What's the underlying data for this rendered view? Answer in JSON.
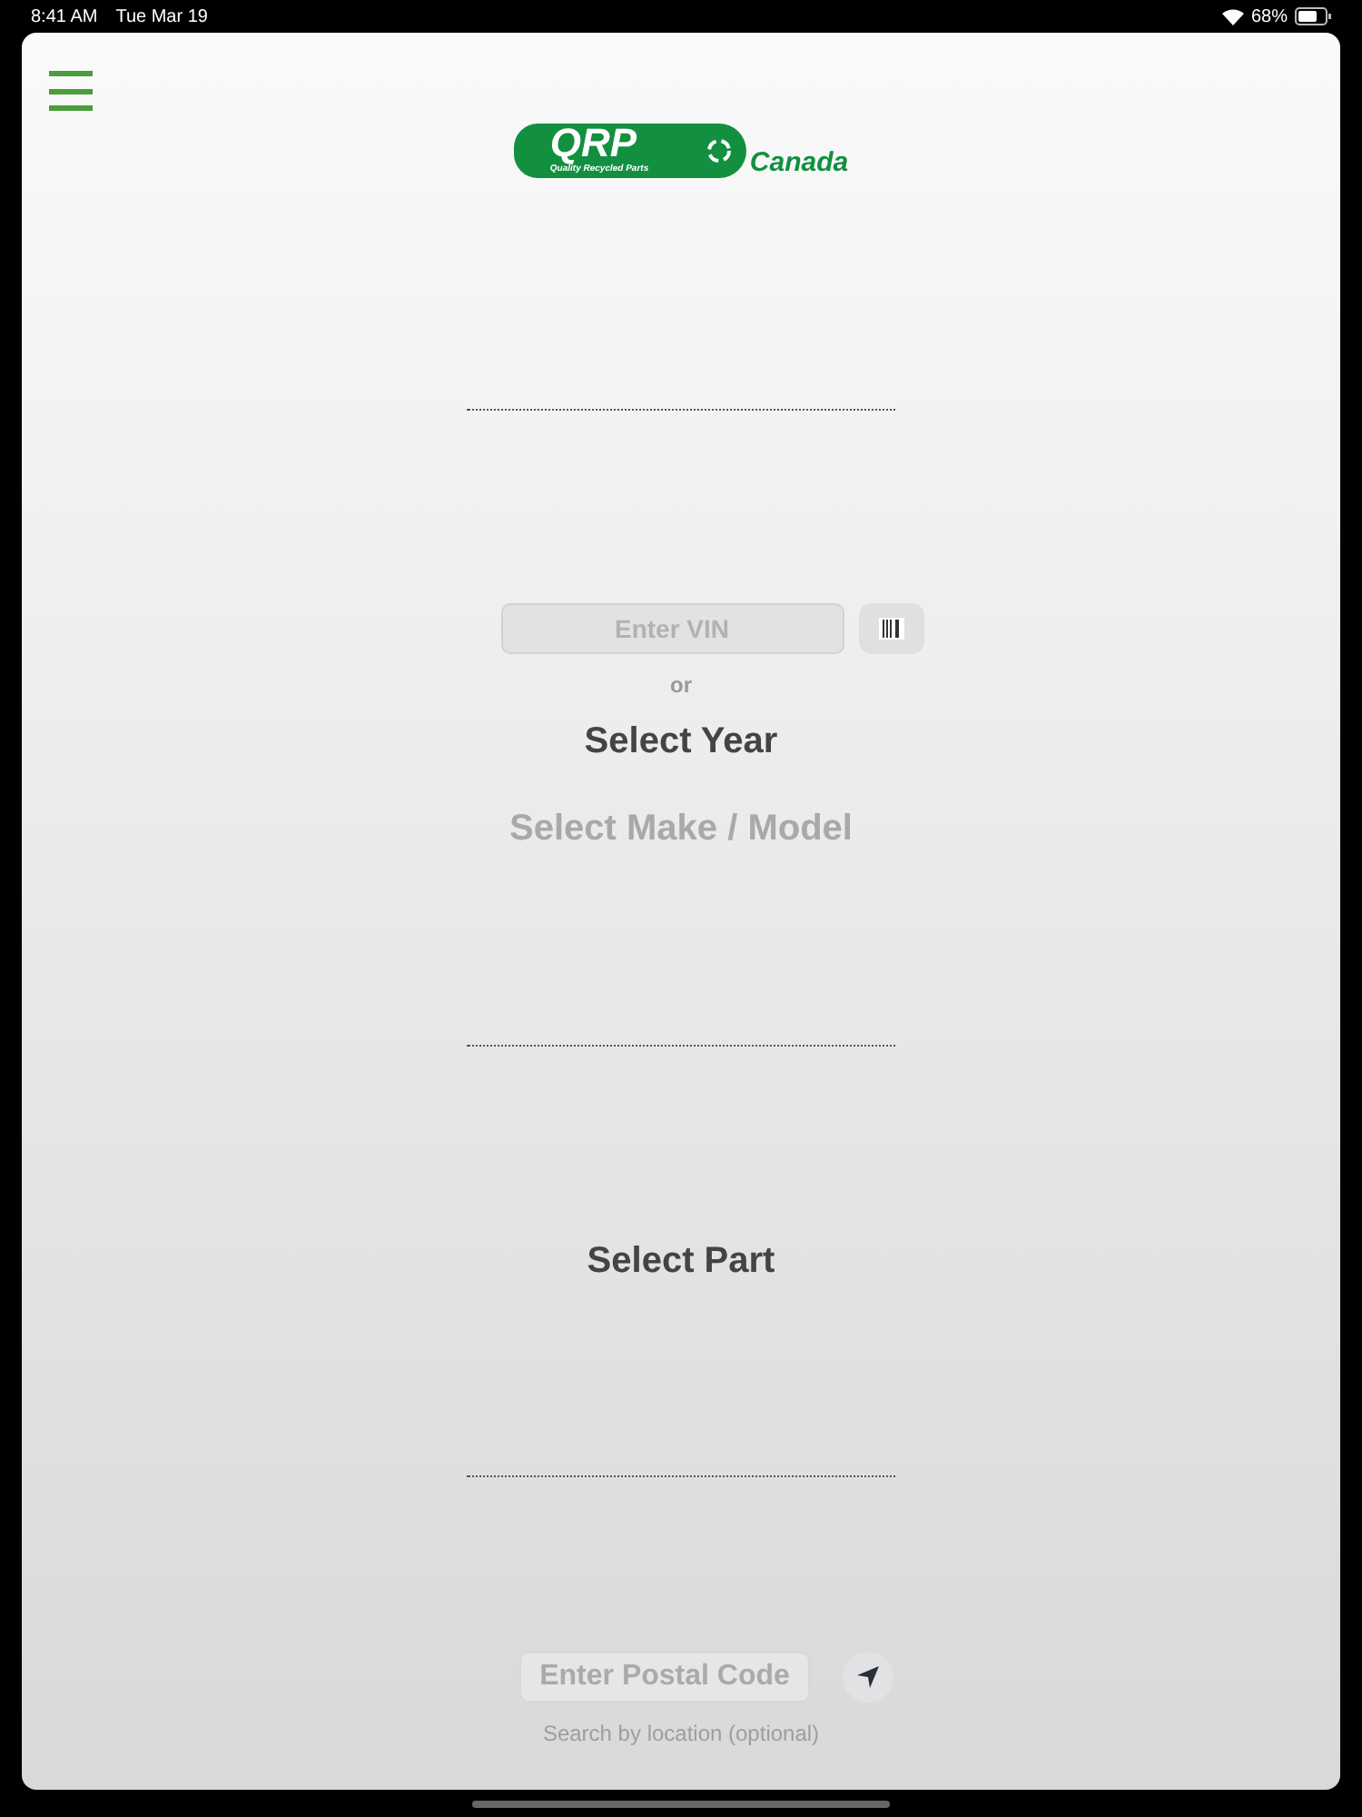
{
  "status_bar": {
    "time": "8:41 AM",
    "date": "Tue Mar 19",
    "battery": "68%"
  },
  "logo": {
    "brand": "QRP",
    "tagline": "Quality Recycled Parts",
    "region": "Canada"
  },
  "vin": {
    "placeholder": "Enter VIN"
  },
  "separator": "or",
  "selectors": [
    {
      "label": "Select Year",
      "disabled": false
    },
    {
      "label": "Select Make / Model",
      "disabled": true
    }
  ],
  "part": {
    "label": "Select Part",
    "disabled": false
  },
  "postal": {
    "placeholder": "Enter Postal Code",
    "hint": "Search by location (optional)"
  }
}
